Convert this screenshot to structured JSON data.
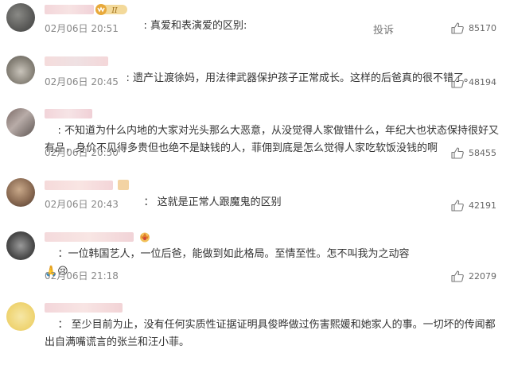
{
  "colors": {
    "text": "#333333",
    "meta": "#888888",
    "like": "#666666"
  },
  "complain_label": "投诉",
  "comments": [
    {
      "prefix": ": ",
      "text": "真爱和表演爱的区别:",
      "time": "02月06日 20:51",
      "likes": "85170",
      "badge": "II",
      "icon": "vip-badge-icon"
    },
    {
      "prefix": ": ",
      "text": "遗产让渡徐妈，用法律武器保护孩子正常成长。这样的后爸真的很不错了。",
      "time": "02月06日 20:45",
      "likes": "48194"
    },
    {
      "prefix": ": ",
      "text": "不知道为什么内地的大家对光头那么大恶意，从没觉得人家做错什么，年纪大也状态保持很好又有品，身价不见得多贵但也绝不是缺钱的人，菲佣到底是怎么觉得人家吃软饭没钱的啊",
      "time": "02月06日 20:50",
      "likes": "58455"
    },
    {
      "prefix": "： ",
      "text": "这就是正常人跟魔鬼的区别",
      "time": "02月06日 20:43",
      "likes": "42191"
    },
    {
      "prefix": "：",
      "text": "一位韩国艺人，一位后爸，能做到如此格局。至情至性。怎不叫我为之动容",
      "emoji": "🙏😢",
      "time": "02月06日 21:18",
      "likes": "22079"
    },
    {
      "prefix": "： ",
      "text": "至少目前为止，没有任何实质性证据证明具俊晔做过伤害熙媛和她家人的事。一切坏的传闻都出自满嘴谎言的张兰和汪小菲。",
      "time": "",
      "likes": ""
    }
  ]
}
